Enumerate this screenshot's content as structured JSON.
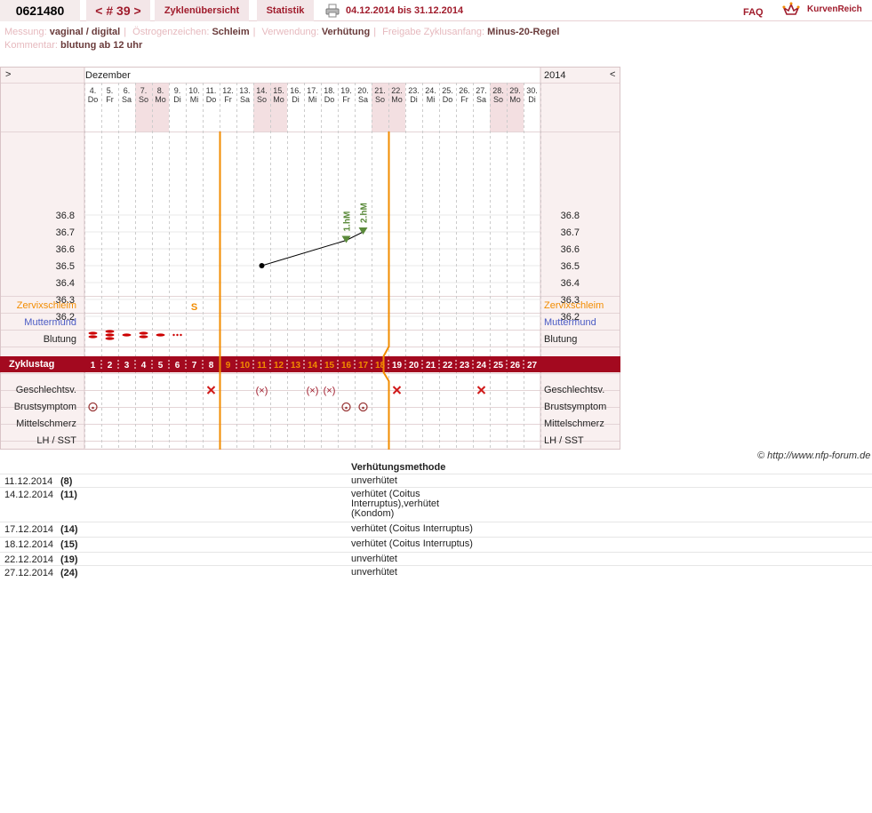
{
  "header": {
    "cycle_id": "0621480",
    "cycle_nav": "< # 39 >",
    "tab_overview": "Zyklenübersicht",
    "tab_stats": "Statistik",
    "date_range": "04.12.2014 bis 31.12.2014",
    "faq": "FAQ",
    "logo_text": "KurvenReich"
  },
  "info": {
    "messung_label": "Messung:",
    "messung": "vaginal / digital",
    "oestrogen_label": "Östrogenzeichen:",
    "oestrogen": "Schleim",
    "verwendung_label": "Verwendung:",
    "verwendung": "Verhütung",
    "freigabe_label": "Freigabe Zyklusanfang:",
    "freigabe": "Minus-20-Regel",
    "kommentar_label": "Kommentar:",
    "kommentar": "blutung ab 12 uhr"
  },
  "chart_header": {
    "nav_left": ">",
    "nav_right": "<",
    "month": "Dezember",
    "year": "2014"
  },
  "chart_data": {
    "type": "line",
    "title": "",
    "days": [
      "4.",
      "5.",
      "6.",
      "7.",
      "8.",
      "9.",
      "10.",
      "11.",
      "12.",
      "13.",
      "14.",
      "15.",
      "16.",
      "17.",
      "18.",
      "19.",
      "20.",
      "21.",
      "22.",
      "23.",
      "24.",
      "25.",
      "26.",
      "27.",
      "28.",
      "29.",
      "30."
    ],
    "weekdays": [
      "Do",
      "Fr",
      "Sa",
      "So",
      "Mo",
      "Di",
      "Mi",
      "Do",
      "Fr",
      "Sa",
      "So",
      "Mo",
      "Di",
      "Mi",
      "Do",
      "Fr",
      "Sa",
      "So",
      "Mo",
      "Di",
      "Mi",
      "Do",
      "Fr",
      "Sa",
      "So",
      "Mo",
      "Di"
    ],
    "weekend_columns": [
      3,
      4,
      10,
      11,
      17,
      18,
      24,
      25
    ],
    "cycle_days": [
      1,
      2,
      3,
      4,
      5,
      6,
      7,
      8,
      9,
      10,
      11,
      12,
      13,
      14,
      15,
      16,
      17,
      18,
      19,
      20,
      21,
      22,
      23,
      24,
      25,
      26,
      27
    ],
    "highlight_cycle_days": [
      9,
      10,
      11,
      12,
      13,
      14,
      15,
      16,
      17,
      18
    ],
    "temperature_ticks": [
      "36.8",
      "36.7",
      "36.6",
      "36.5",
      "36.4",
      "36.3",
      "36.2"
    ],
    "ylim": [
      36.05,
      36.95
    ],
    "temperatures": [
      {
        "cycle_day": 11,
        "value": 36.5
      },
      {
        "cycle_day": 16,
        "value": 36.65
      },
      {
        "cycle_day": 17,
        "value": 36.7
      }
    ],
    "markers": [
      {
        "cycle_day": 16,
        "label": "1.hM"
      },
      {
        "cycle_day": 17,
        "label": "2.hM"
      }
    ],
    "vertical_lines_after_cycle_day": [
      8,
      18
    ],
    "zervix": [
      {
        "cycle_day": 7,
        "label": "S"
      }
    ],
    "bleeding": [
      {
        "cycle_day": 1,
        "level": 2
      },
      {
        "cycle_day": 2,
        "level": 3
      },
      {
        "cycle_day": 3,
        "level": 1
      },
      {
        "cycle_day": 4,
        "level": 2
      },
      {
        "cycle_day": 5,
        "level": 1
      },
      {
        "cycle_day": 6,
        "level": 0
      }
    ],
    "intercourse": [
      {
        "cycle_day": 8,
        "type": "x"
      },
      {
        "cycle_day": 11,
        "type": "cx"
      },
      {
        "cycle_day": 14,
        "type": "cx"
      },
      {
        "cycle_day": 15,
        "type": "cx"
      },
      {
        "cycle_day": 19,
        "type": "x"
      },
      {
        "cycle_day": 24,
        "type": "x"
      }
    ],
    "breast": [
      1,
      16,
      17
    ]
  },
  "rows": {
    "zervix": "Zervixschleim",
    "muttermund": "Muttermund",
    "blutung": "Blutung",
    "zyklustag": "Zyklustag",
    "gv": "Geschlechtsv.",
    "brust": "Brustsymptom",
    "mittel": "Mittelschmerz",
    "lh": "LH / SST"
  },
  "colors": {
    "accent": "#a01c2c",
    "orange": "#f28c00",
    "blue": "#4a5bc4",
    "green": "#5a8a3a"
  },
  "credit": "© http://www.nfp-forum.de",
  "table": {
    "header": "Verhütungsmethode",
    "rows": [
      {
        "date": "11.12.2014",
        "num": "(8)",
        "method": "unverhütet"
      },
      {
        "date": "14.12.2014",
        "num": "(11)",
        "method": "verhütet (Coitus Interruptus),verhütet (Kondom)"
      },
      {
        "date": "17.12.2014",
        "num": "(14)",
        "method": "verhütet (Coitus Interruptus)"
      },
      {
        "date": "18.12.2014",
        "num": "(15)",
        "method": "verhütet (Coitus Interruptus)"
      },
      {
        "date": "22.12.2014",
        "num": "(19)",
        "method": "unverhütet"
      },
      {
        "date": "27.12.2014",
        "num": "(24)",
        "method": "unverhütet"
      }
    ]
  }
}
